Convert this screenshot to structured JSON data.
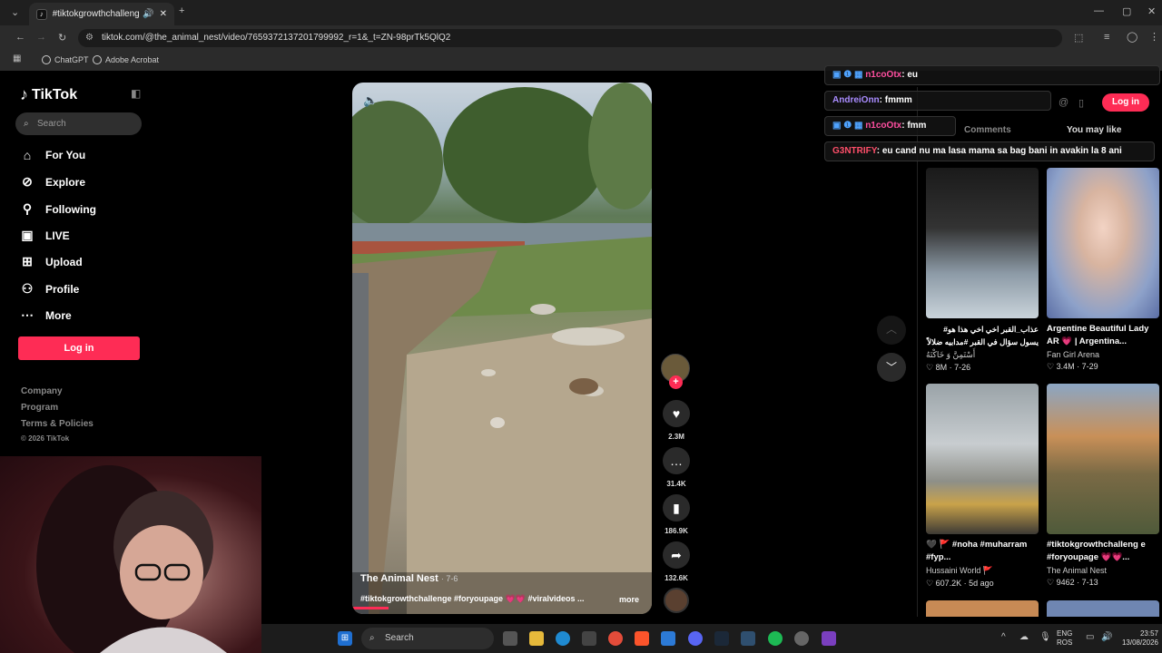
{
  "browser": {
    "tab_title": "#tiktokgrowthchallenge #fo",
    "url": "tiktok.com/@the_animal_nest/video/7659372137201799992_r=1&_t=ZN-98prTk5QlQ2",
    "bookmarks": [
      "ChatGPT",
      "Adobe Acrobat"
    ]
  },
  "sidebar": {
    "logo": "TikTok",
    "search_placeholder": "Search",
    "items": [
      {
        "label": "For You",
        "icon": "home-icon"
      },
      {
        "label": "Explore",
        "icon": "compass-icon"
      },
      {
        "label": "Following",
        "icon": "following-icon"
      },
      {
        "label": "LIVE",
        "icon": "live-icon"
      },
      {
        "label": "Upload",
        "icon": "upload-icon"
      },
      {
        "label": "Profile",
        "icon": "profile-icon"
      },
      {
        "label": "More",
        "icon": "more-icon"
      }
    ],
    "login_label": "Log in",
    "footer": [
      "Company",
      "Program",
      "Terms & Policies",
      "© 2026 TikTok"
    ]
  },
  "video": {
    "author": "The Animal Nest",
    "date": "· 7-6",
    "caption": "#tiktokgrowthchallenge #foryoupage 💗💗 #viralvideos ...",
    "more_label": "more",
    "likes": "2.3M",
    "comments": "31.4K",
    "saves": "186.9K",
    "shares": "132.6K"
  },
  "right_panel": {
    "login_label": "Log in",
    "tabs": [
      "Comments",
      "You may like"
    ],
    "chat": [
      {
        "user": "n1coOtx",
        "msg": ": eu",
        "color": "#ff4fa0"
      },
      {
        "user": "AndreiOnn",
        "msg": ": fmmm",
        "color": "#a98cff"
      },
      {
        "user": "n1coOtx",
        "msg": ": fmm",
        "color": "#ff4fa0"
      },
      {
        "user": "G3NTRIFY",
        "msg": ": eu cand nu ma lasa mama sa bag bani in avakin la 8 ani",
        "color": "#ff4f6a"
      }
    ],
    "cards": [
      {
        "title": "عذاب_القبر اخي اخي هذا هو# يسول سؤال في القبر #مدابيه ضلالاً",
        "author": "أَسْتَمِنَّ وَ خَاكْتَهُ",
        "views": "8M",
        "date": "7-26"
      },
      {
        "title": "Argentine Beautiful Lady AR 💗 | Argentina...",
        "author": "Fan Girl Arena",
        "views": "3.4M",
        "date": "7-29"
      },
      {
        "title": "🖤 🚩 #noha #muharram #fyp...",
        "author": "Hussaini World 🚩",
        "views": "607.2K",
        "date": "5d ago"
      },
      {
        "title": "#tiktokgrowthchalleng e #foryoupage 💗💗...",
        "author": "The Animal Nest",
        "views": "9462",
        "date": "7-13"
      }
    ]
  },
  "taskbar": {
    "search_placeholder": "Search",
    "lang": "ENG",
    "lang2": "ROS",
    "time": "23:57",
    "date": "13/08/2026"
  }
}
